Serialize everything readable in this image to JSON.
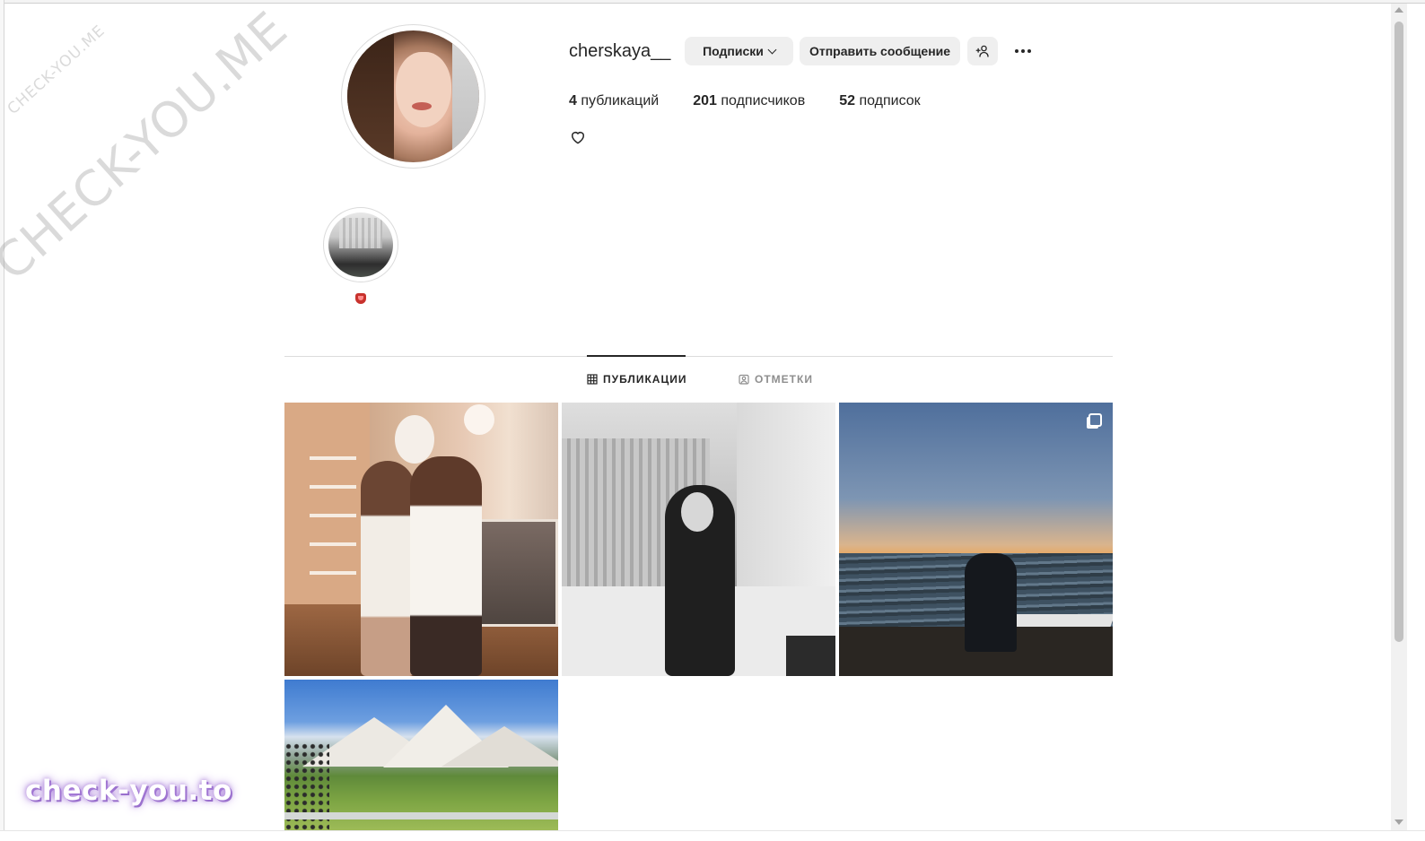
{
  "watermarks": {
    "small": "CHECK-YOU.ME",
    "large": "CHECK-YOU.ME",
    "bottom": "check-you.to"
  },
  "profile": {
    "username": "cherskaya__",
    "buttons": {
      "following": "Подписки",
      "message": "Отправить сообщение",
      "add_user_icon": "person-plus-icon",
      "more_icon": "more-horizontal-icon"
    },
    "stats": [
      {
        "value": "4",
        "label": "публикаций"
      },
      {
        "value": "201",
        "label": "подписчиков"
      },
      {
        "value": "52",
        "label": "подписок"
      }
    ],
    "bio_icon": "heart-icon"
  },
  "highlights": [
    {
      "label": "👅"
    }
  ],
  "tabs": [
    {
      "label": "ПУБЛИКАЦИИ",
      "icon": "grid-icon",
      "active": true
    },
    {
      "label": "ОТМЕТКИ",
      "icon": "tag-person-icon",
      "active": false
    }
  ],
  "posts": [
    {
      "description_icon": "photo"
    },
    {
      "description_icon": "photo"
    },
    {
      "description_icon": "photo",
      "multi": true
    },
    {
      "description_icon": "photo"
    }
  ],
  "colors": {
    "button_bg": "#efefef",
    "text": "#262626",
    "muted": "#8e8e8e",
    "divider": "#dbdbdb"
  }
}
